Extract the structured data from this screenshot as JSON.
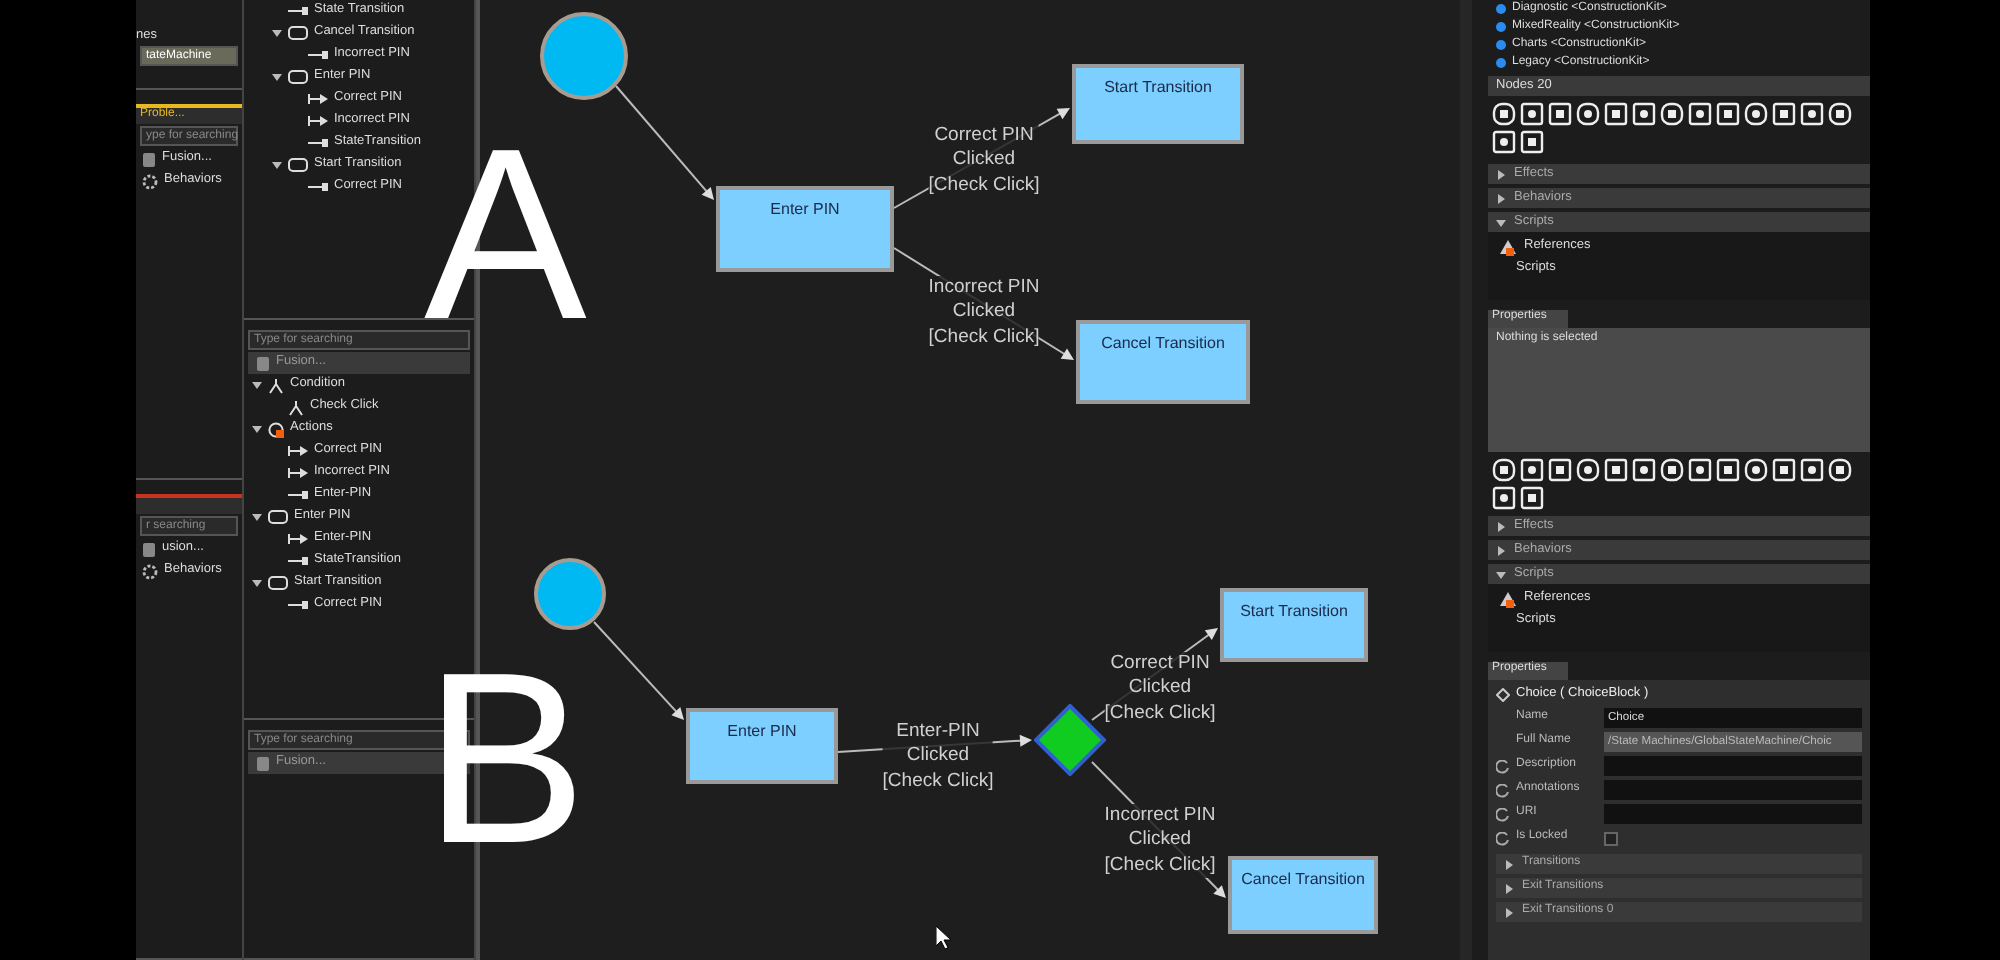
{
  "left_strip": {
    "caption": "nes",
    "field_value": "tateMachine",
    "panels": [
      {
        "tab": {
          "label": "Proble...",
          "color": "#e8b820"
        },
        "search": {
          "placeholder": "ype for searching"
        },
        "items": [
          {
            "kind": "fusion",
            "label": "Fusion..."
          },
          {
            "kind": "behaviors",
            "label": "Behaviors"
          }
        ]
      },
      {
        "tab": {
          "color": "#c8321e"
        },
        "search": {
          "placeholder": "r searching"
        },
        "items": [
          {
            "kind": "fusion",
            "label": "usion..."
          },
          {
            "kind": "behaviors",
            "label": "Behaviors"
          }
        ]
      }
    ]
  },
  "outline": {
    "items": [
      {
        "kind": "incoming",
        "label": "State Transition"
      },
      {
        "kind": "state",
        "label": "Cancel Transition",
        "expanded": true,
        "children": [
          {
            "kind": "incoming",
            "label": "Incorrect PIN"
          }
        ]
      },
      {
        "kind": "state",
        "label": "Enter PIN",
        "expanded": true,
        "children": [
          {
            "kind": "outgoing",
            "label": "Correct PIN"
          },
          {
            "kind": "outgoing",
            "label": "Incorrect PIN"
          },
          {
            "kind": "incoming",
            "label": "StateTransition"
          }
        ]
      },
      {
        "kind": "state",
        "label": "Start Transition",
        "expanded": true,
        "children": [
          {
            "kind": "incoming",
            "label": "Correct PIN"
          }
        ]
      }
    ]
  },
  "condition_panel": {
    "search": {
      "placeholder": "Type for searching"
    },
    "source": "Fusion...",
    "items": [
      {
        "kind": "condition",
        "label": "Condition",
        "expanded": true,
        "children": [
          {
            "kind": "condition",
            "label": "Check Click"
          }
        ]
      },
      {
        "kind": "action",
        "label": "Actions",
        "expanded": true,
        "children": [
          {
            "kind": "outgoing",
            "label": "Correct PIN"
          },
          {
            "kind": "outgoing",
            "label": "Incorrect PIN"
          },
          {
            "kind": "incoming",
            "label": "Enter-PIN"
          }
        ]
      },
      {
        "kind": "state",
        "label": "Enter PIN",
        "expanded": true,
        "children": [
          {
            "kind": "outgoing",
            "label": "Enter-PIN"
          },
          {
            "kind": "incoming",
            "label": "StateTransition"
          }
        ]
      },
      {
        "kind": "state",
        "label": "Start Transition",
        "expanded": true,
        "children": [
          {
            "kind": "incoming",
            "label": "Correct PIN"
          }
        ]
      }
    ]
  },
  "bottom_panel": {
    "search": {
      "placeholder": "Type for searching"
    },
    "source": "Fusion..."
  },
  "diagrams": [
    {
      "letter": "A",
      "nodes": [
        {
          "kind": "initial"
        },
        {
          "kind": "state",
          "label": "Enter PIN"
        },
        {
          "kind": "state",
          "label": "Start Transition"
        },
        {
          "kind": "state",
          "label": "Cancel Transition"
        }
      ],
      "edges": [
        {
          "kind": "plain"
        },
        {
          "kind": "labeled",
          "lines": [
            "Correct PIN",
            "Clicked",
            "[Check Click]"
          ]
        },
        {
          "kind": "labeled",
          "lines": [
            "Incorrect PIN",
            "Clicked",
            "[Check Click]"
          ]
        }
      ]
    },
    {
      "letter": "B",
      "nodes": [
        {
          "kind": "initial"
        },
        {
          "kind": "state",
          "label": "Enter PIN"
        },
        {
          "kind": "choice"
        },
        {
          "kind": "state",
          "label": "Start Transition"
        },
        {
          "kind": "state",
          "label": "Cancel Transition"
        }
      ],
      "edges": [
        {
          "kind": "plain"
        },
        {
          "kind": "labeled",
          "lines": [
            "Enter-PIN",
            "Clicked",
            "[Check Click]"
          ]
        },
        {
          "kind": "labeled",
          "lines": [
            "Correct PIN",
            "Clicked",
            "[Check Click]"
          ]
        },
        {
          "kind": "labeled",
          "lines": [
            "Incorrect PIN",
            "Clicked",
            "[Check Click]"
          ]
        }
      ]
    }
  ],
  "right_panel": {
    "packages": [
      {
        "label": "Diagnostic <ConstructionKit>"
      },
      {
        "label": "MixedReality <ConstructionKit>"
      },
      {
        "label": "Charts <ConstructionKit>"
      },
      {
        "label": "Legacy <ConstructionKit>"
      }
    ],
    "inspectors": [
      {
        "toolbox_title": "Nodes 20",
        "sections": [
          {
            "label": "Effects",
            "expanded": false
          },
          {
            "label": "Behaviors",
            "expanded": false
          },
          {
            "label": "Scripts",
            "expanded": true,
            "items": [
              {
                "kind": "references",
                "label": "References"
              },
              {
                "kind": "plain",
                "label": "Scripts"
              }
            ]
          }
        ],
        "properties": {
          "tab": "Properties",
          "message": "Nothing is selected"
        }
      },
      {
        "sections": [
          {
            "label": "Effects",
            "expanded": false
          },
          {
            "label": "Behaviors",
            "expanded": false
          },
          {
            "label": "Scripts",
            "expanded": true,
            "items": [
              {
                "kind": "references",
                "label": "References"
              },
              {
                "kind": "plain",
                "label": "Scripts"
              }
            ]
          }
        ],
        "properties": {
          "tab": "Properties",
          "title": "Choice ( ChoiceBlock )",
          "fields": [
            {
              "kind": "text",
              "label": "Name",
              "value": "Choice",
              "disabled": false,
              "resettable": false
            },
            {
              "kind": "text",
              "label": "Full Name",
              "value": "/State Machines/GlobalStateMachine/Choic",
              "disabled": true,
              "resettable": false
            },
            {
              "kind": "text",
              "label": "Description",
              "disabled": false,
              "resettable": true
            },
            {
              "kind": "text",
              "label": "Annotations",
              "disabled": false,
              "resettable": true
            },
            {
              "kind": "text",
              "label": "URI",
              "disabled": false,
              "resettable": true
            },
            {
              "kind": "check",
              "label": "Is Locked",
              "checked": false,
              "resettable": true
            }
          ],
          "groups": [
            {
              "label": "Transitions",
              "expanded": false
            },
            {
              "label": "Exit Transitions",
              "expanded": false
            },
            {
              "label": "Exit Transitions 0",
              "expanded": false
            }
          ]
        }
      }
    ]
  }
}
